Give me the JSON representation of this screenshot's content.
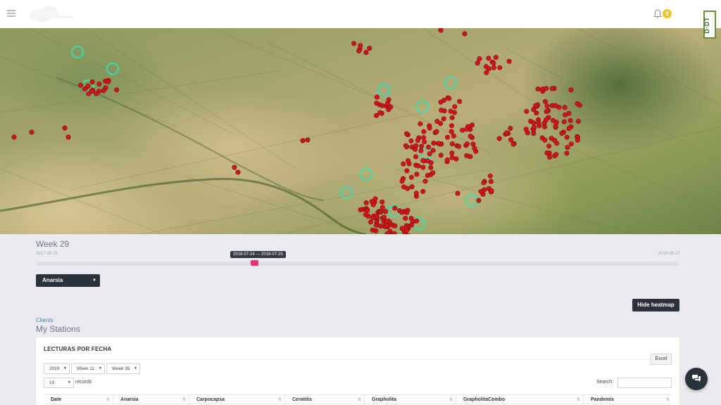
{
  "header": {
    "notification_count": "0",
    "ddt_logo": "D·DT"
  },
  "map": {
    "zoom_in": "+",
    "zoom_out": "−",
    "point_color": "#d4141c",
    "heat_color": "#3ddcb0"
  },
  "timeline": {
    "week_label": "Week 29",
    "start_date": "2017-05-25",
    "end_date": "2019-08-27",
    "selected_range": "2018-07-24 — 2018-07-25"
  },
  "filter": {
    "pest_selected": "Anarsia"
  },
  "actions": {
    "heatmap_button": "Hide heatmap"
  },
  "breadcrumb": "Clients",
  "page_title": "My Stations",
  "table_panel": {
    "title": "LECTURAS POR FECHA",
    "excel_button": "Excel",
    "year_select": "2019",
    "week_from_select": "Week 11",
    "week_to_select": "Week 35",
    "page_size_select": "10",
    "records_label": "records",
    "search_label": "Search:",
    "search_value": "",
    "columns": [
      "Date",
      "Anarsia",
      "Carpocapsa",
      "Ceratitis",
      "Grapholita",
      "GrapholitaCombo",
      "Pandemis"
    ]
  }
}
